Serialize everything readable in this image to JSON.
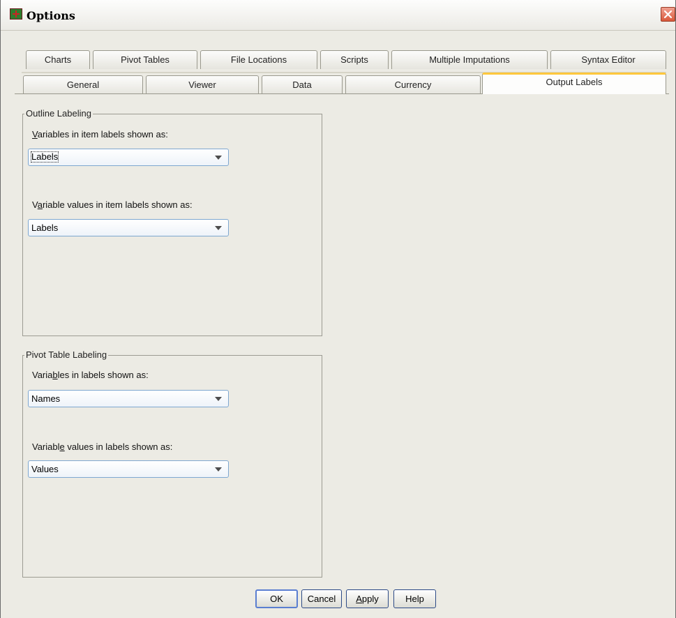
{
  "window": {
    "title": "Options"
  },
  "tabs": {
    "row_back": [
      {
        "label": "Charts"
      },
      {
        "label": "Pivot Tables"
      },
      {
        "label": "File Locations"
      },
      {
        "label": "Scripts"
      },
      {
        "label": "Multiple Imputations"
      },
      {
        "label": "Syntax Editor"
      }
    ],
    "row_front": [
      {
        "label": "General"
      },
      {
        "label": "Viewer"
      },
      {
        "label": "Data"
      },
      {
        "label": "Currency"
      },
      {
        "label": "Output Labels",
        "selected": true
      }
    ]
  },
  "outline_labeling": {
    "legend": "Outline Labeling",
    "variables_label": {
      "mnemonic": "V",
      "rest": "ariables in item labels shown as:"
    },
    "variables_value": "Labels",
    "values_label": {
      "pre": "V",
      "mnemonic": "a",
      "rest": "riable values in item labels shown as:"
    },
    "values_value": "Labels"
  },
  "pivot_table_labeling": {
    "legend": "Pivot Table Labeling",
    "variables_label": {
      "pre": "Varia",
      "mnemonic": "b",
      "rest": "les in labels shown as:"
    },
    "variables_value": "Names",
    "values_label": {
      "pre": "Variabl",
      "mnemonic": "e",
      "rest": " values in labels shown as:"
    },
    "values_value": "Values"
  },
  "buttons": {
    "ok": "OK",
    "cancel": "Cancel",
    "apply": {
      "mnemonic": "A",
      "rest": "pply"
    },
    "help": "Help"
  },
  "colors": {
    "dialog_bg": "#ecebe4",
    "active_tab_accent": "#ffc73c",
    "close_button": "#d9593b",
    "button_border": "#2c4a86"
  },
  "icons": {
    "app": "spss-options-icon",
    "close": "close-icon",
    "dropdown": "chevron-down-icon"
  }
}
